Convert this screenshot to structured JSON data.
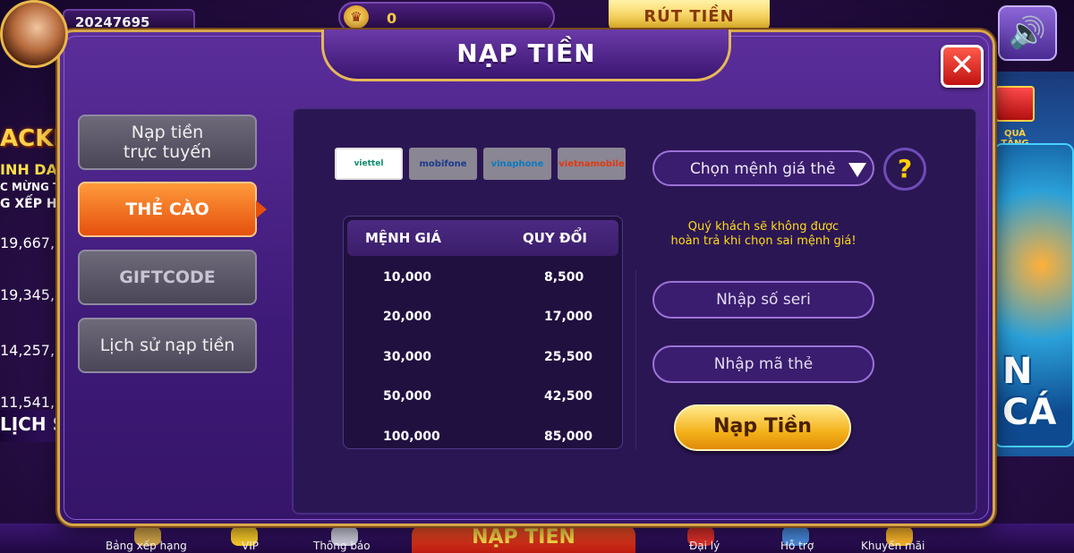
{
  "lobby": {
    "user_id": "20247695",
    "coins": "0",
    "withdraw_label": "RÚT TIỀN",
    "jackpot_text": "ACKP",
    "leaderboard": [
      "INH DA",
      "C MỪNG T",
      "G XẾP H",
      "19,667,",
      "19,345,",
      "14,257,",
      "11,541,"
    ],
    "history_label": "LỊCH S",
    "gift_label": "QUÀ TẶNG",
    "game_label": "N CÁ",
    "bottom_nav": [
      "Bảng xếp hạng",
      "VIP",
      "Thông báo",
      "NẠP TIỀN",
      "Đại lý",
      "Hỗ trợ",
      "Khuyến mãi"
    ]
  },
  "modal": {
    "title": "NẠP TIỀN",
    "close_icon": "close-icon"
  },
  "tabs": [
    {
      "line1": "Nạp tiền",
      "line2": "trực tuyến"
    },
    {
      "label": "THẺ CÀO",
      "active": true
    },
    {
      "label": "GIFTCODE"
    },
    {
      "label": "Lịch sử nạp tiền"
    }
  ],
  "carriers": [
    "viettel",
    "mobifone",
    "vinaphone",
    "vietnamobile"
  ],
  "rates": {
    "header": [
      "MỆNH GIÁ",
      "QUY ĐỔI"
    ],
    "rows": [
      [
        "10,000",
        "8,500"
      ],
      [
        "20,000",
        "17,000"
      ],
      [
        "30,000",
        "25,500"
      ],
      [
        "50,000",
        "42,500"
      ],
      [
        "100,000",
        "85,000"
      ]
    ]
  },
  "form": {
    "denomination_select": "Chọn mệnh giá thẻ",
    "help": "?",
    "warning_line1": "Quý khách sẽ không được",
    "warning_line2": "hoàn trả khi chọn sai mệnh giá!",
    "serial_placeholder": "Nhập số seri",
    "code_placeholder": "Nhập mã thẻ",
    "submit": "Nạp Tiền"
  },
  "colors": {
    "accent": "#e5500e",
    "gold": "#f4b21a",
    "warning": "#ffdc1a",
    "panel": "#2b1654"
  }
}
